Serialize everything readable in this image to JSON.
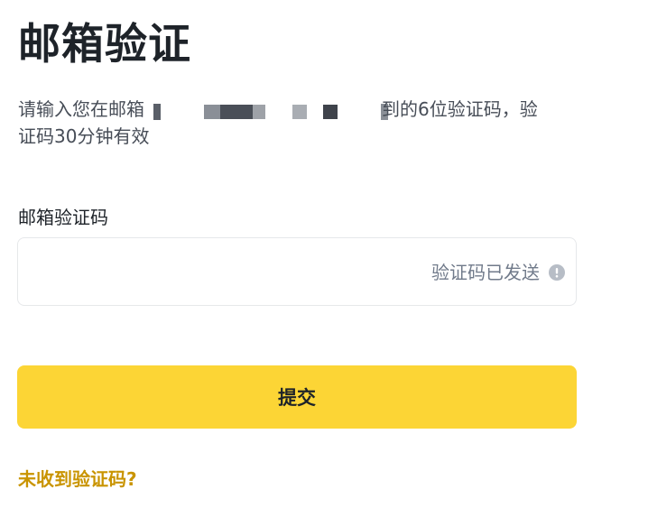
{
  "page": {
    "title": "邮箱验证"
  },
  "description": {
    "line1_prefix": "请输入您在邮箱",
    "line1_suffix": "到的6位验证码，验",
    "line2": "证码30分钟有效"
  },
  "code_field": {
    "label": "邮箱验证码",
    "value": "",
    "placeholder": "",
    "status_text": "验证码已发送",
    "status_icon": "info-icon"
  },
  "submit": {
    "label": "提交"
  },
  "help_link": {
    "label": "未收到验证码?"
  },
  "colors": {
    "accent": "#fcd535",
    "link": "#c99400",
    "text": "#1e2329",
    "secondary_text": "#707a8a",
    "border": "#e6e8ea"
  }
}
